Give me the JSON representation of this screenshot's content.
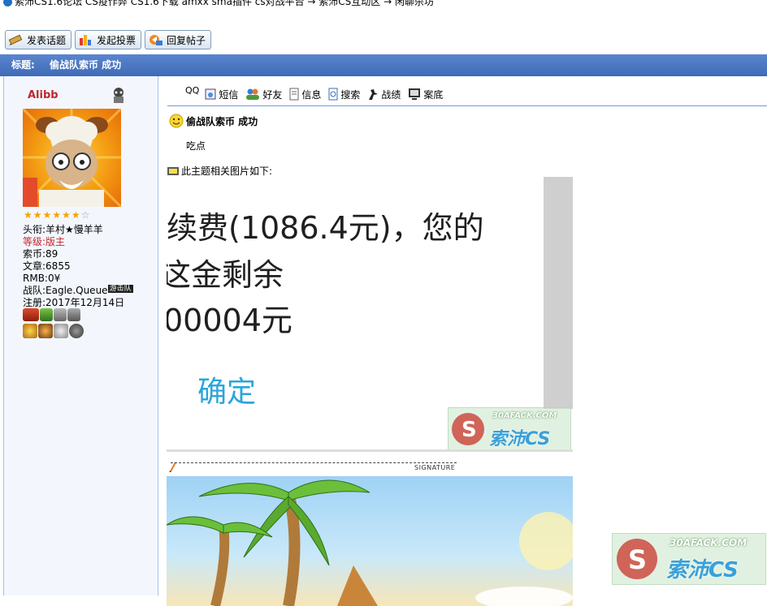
{
  "breadcrumb": {
    "text": "索沛CS1.6论坛 CS疫作弊 CS1.6下载 amxx sma插件 cs对战平台 → 索沛CS互动区 → 闲聊杀坊"
  },
  "toolbar": {
    "new_topic": "发表话题",
    "new_poll": "发起投票",
    "reply": "回复帖子"
  },
  "thread": {
    "label": "标题:",
    "title": "偷战队索币 成功"
  },
  "user": {
    "name": "Alibb",
    "stars_filled": 6,
    "stars_total": 7,
    "title_label": "头衔:",
    "title_value": "羊村★慢羊羊",
    "level_label": "等级:",
    "level_value": "版主",
    "coins_label": "索币:",
    "coins_value": "89",
    "posts_label": "文章:",
    "posts_value": "6855",
    "rmb_label": "RMB:",
    "rmb_value": "0¥",
    "team_label": "战队:",
    "team_value": "Eagle.Queue",
    "team_badge": "游击队",
    "reg_label": "注册:",
    "reg_value": "2017年12月14日"
  },
  "actions": {
    "qq": "QQ",
    "pm": "短信",
    "friend": "好友",
    "info": "信息",
    "search": "搜索",
    "record": "战绩",
    "archive": "案底"
  },
  "post": {
    "title": "偷战队索币 成功",
    "body": "吃点",
    "pic_note": "此主题相关图片如下:"
  },
  "screenshot_text": {
    "line1": "续费(1086.4元)，您的",
    "line2": "这金剩余",
    "line3": "00004元",
    "confirm": "确定"
  },
  "watermark": {
    "top": "30AFACK.COM",
    "main": "索沛CS"
  },
  "signature": {
    "label": "SIGNATURE"
  },
  "colors": {
    "title_bar": "#4a78c4",
    "username": "#c0272d",
    "level": "#c0272d",
    "confirm_blue": "#2aa5dc",
    "link_blue": "#1f6fc5"
  }
}
